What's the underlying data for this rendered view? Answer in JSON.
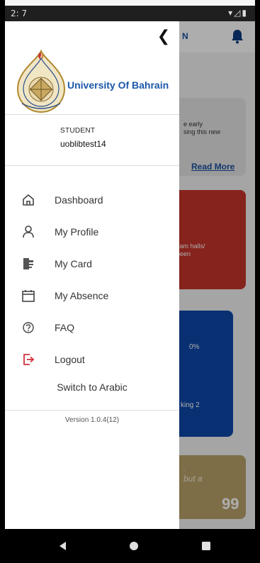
{
  "status_bar": {
    "time": "2: 7",
    "icons": "▾◿▮"
  },
  "background_app": {
    "title_fragment": "N",
    "card1_text": "e early\nsing this new",
    "card1_link": "Read More",
    "card2_text": "xam halls/\nbeen",
    "card3_percent": "0%",
    "card3_text": "king 2",
    "card4_line1": ".",
    "card4_line2": "but a",
    "card4_quote": "99",
    "colors": {
      "card2": "#c6342b",
      "card3": "#0d47a8",
      "card4": "#b9a36a"
    }
  },
  "drawer": {
    "close_icon": "chevron-left-icon",
    "university_name": "University Of Bahrain",
    "role": "STUDENT",
    "username": "uoblibtest14",
    "menu": [
      {
        "label": "Dashboard",
        "icon": "home-icon"
      },
      {
        "label": "My Profile",
        "icon": "person-icon"
      },
      {
        "label": "My Card",
        "icon": "id-card-icon"
      },
      {
        "label": "My Absence",
        "icon": "calendar-icon"
      },
      {
        "label": "FAQ",
        "icon": "question-icon"
      },
      {
        "label": "Logout",
        "icon": "logout-icon"
      }
    ],
    "switch_language": "Switch to Arabic",
    "version": "Version 1.0.4(12)"
  },
  "nav_bar": {
    "back": "back-icon",
    "home": "home-circle-icon",
    "recents": "recents-icon"
  }
}
